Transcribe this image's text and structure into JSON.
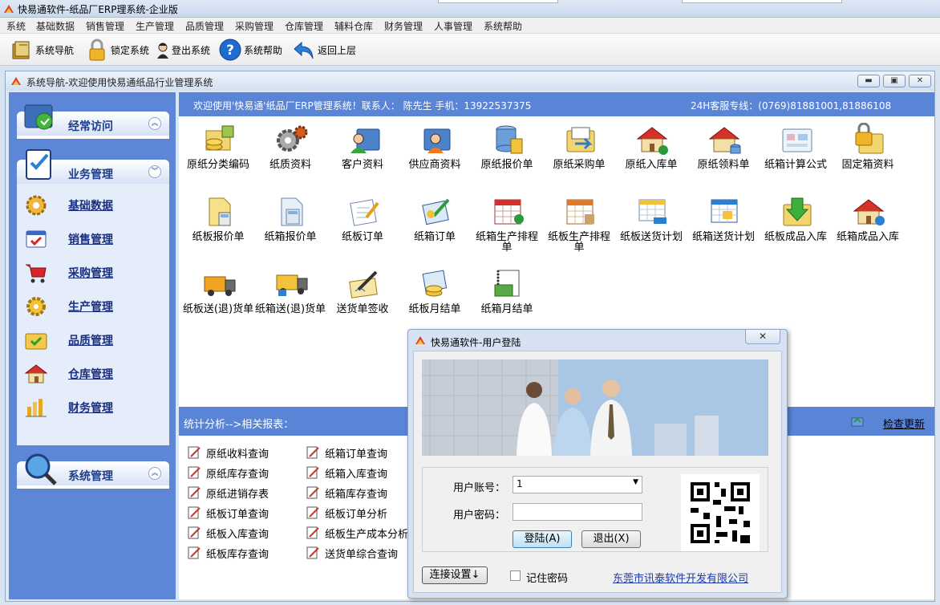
{
  "app": {
    "title": "快易通软件-纸品厂ERP理系统-企业版"
  },
  "menu": [
    "系统",
    "基础数据",
    "销售管理",
    "生产管理",
    "品质管理",
    "采购管理",
    "仓库管理",
    "辅料仓库",
    "财务管理",
    "人事管理",
    "系统帮助"
  ],
  "toolbar": {
    "nav": "系统导航",
    "lock": "锁定系统",
    "logout": "登出系统",
    "help": "系统帮助",
    "back": "返回上层"
  },
  "window": {
    "title": "系统导航-欢迎使用快易通纸品行业管理系统"
  },
  "sidebar": {
    "frequent": "经常访问",
    "business": "业务管理",
    "system": "系统管理",
    "items": [
      "基础数据",
      "销售管理",
      "采购管理",
      "生产管理",
      "品质管理",
      "仓库管理",
      "财务管理"
    ]
  },
  "welcome": {
    "text": "欢迎使用'快易通'纸品厂ERP管理系统！联系人：  陈先生  手机：13922537375",
    "hotline": "24H客服专线：(0769)81881001,81886108"
  },
  "modules": [
    [
      "原纸分类编码",
      "纸质资料",
      "客户资料",
      "供应商资料",
      "原纸报价单",
      "原纸采购单",
      "原纸入库单",
      "原纸领料单",
      "纸箱计算公式",
      "固定箱资料"
    ],
    [
      "纸板报价单",
      "纸箱报价单",
      "纸板订单",
      "纸箱订单",
      "纸箱生产排程单",
      "纸板生产排程单",
      "纸板送货计划",
      "纸箱送货计划",
      "纸板成品入库",
      "纸箱成品入库"
    ],
    [
      "纸板送(退)货单",
      "纸箱送(退)货单",
      "送货单签收",
      "纸板月结单",
      "纸箱月结单"
    ]
  ],
  "stats": {
    "title": "统计分析-->相关报表：",
    "update": "检查更新",
    "col1": [
      "原纸收料查询",
      "原纸库存查询",
      "原纸进销存表",
      "纸板订单查询",
      "纸板入库查询",
      "纸板库存查询"
    ],
    "col2": [
      "纸箱订单查询",
      "纸箱入库查询",
      "纸箱库存查询",
      "纸板订单分析",
      "纸板生产成本分析",
      "送货单综合查询"
    ]
  },
  "login": {
    "title": "快易通软件-用户登陆",
    "close": "✕",
    "user_label": "用户账号：",
    "user_value": "1",
    "pass_label": "用户密码：",
    "login_btn": "登陆(A)",
    "exit_btn": "退出(X)",
    "conn_btn": "连接设置↓",
    "remember": "记住密码",
    "company": "东莞市讯泰软件开发有限公司"
  }
}
